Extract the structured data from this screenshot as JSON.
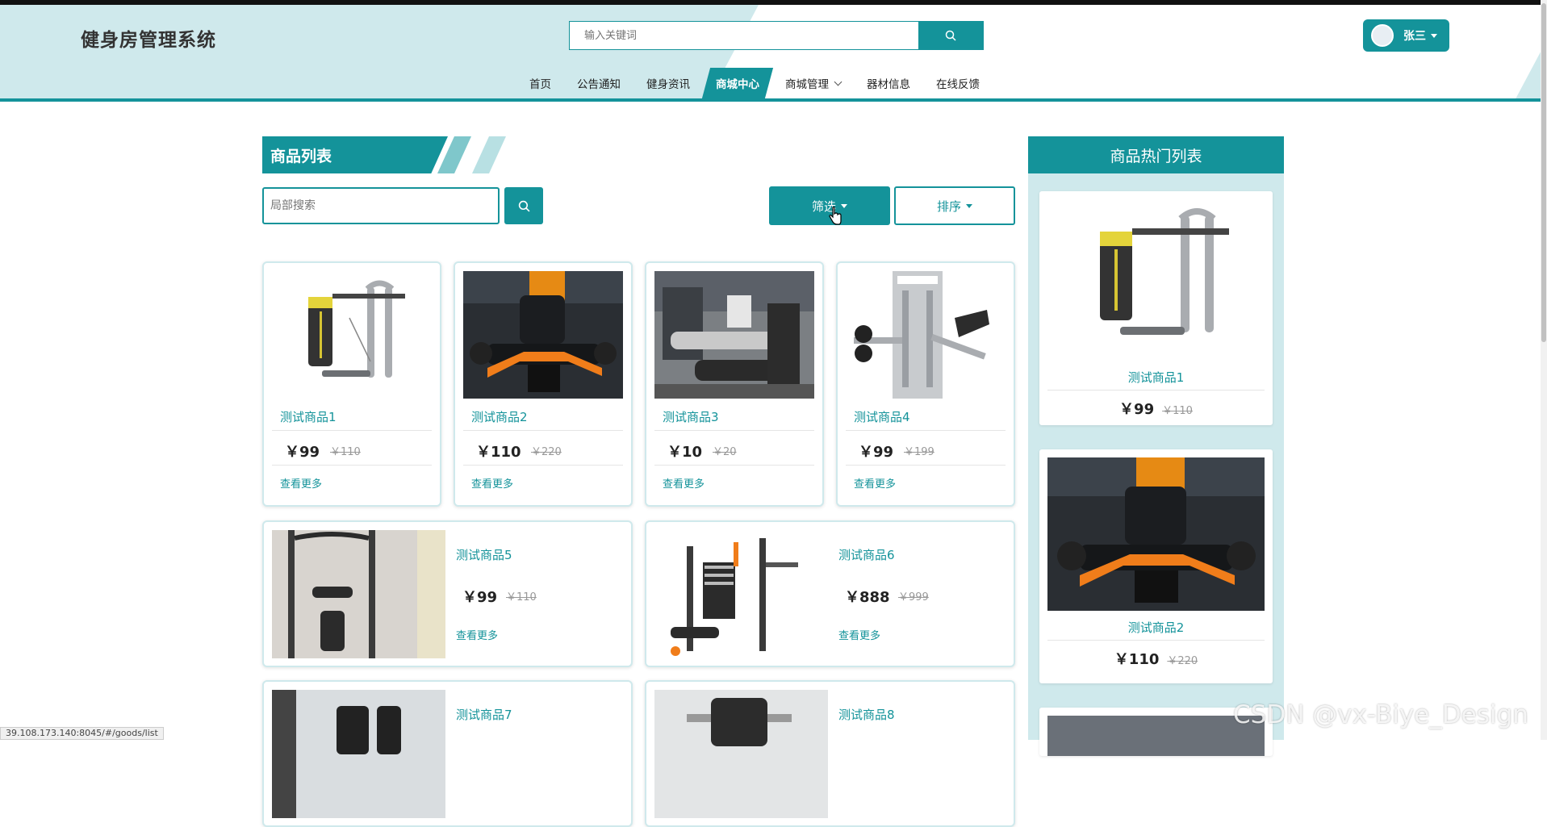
{
  "app": {
    "title": "健身房管理系统"
  },
  "search": {
    "placeholder": "输入关键词"
  },
  "user": {
    "name": "张三"
  },
  "nav": [
    {
      "label": "首页"
    },
    {
      "label": "公告通知"
    },
    {
      "label": "健身资讯"
    },
    {
      "label": "商城中心",
      "active": true
    },
    {
      "label": "商城管理",
      "dropdown": true
    },
    {
      "label": "器材信息"
    },
    {
      "label": "在线反馈"
    }
  ],
  "main": {
    "section_title": "商品列表",
    "local_search_placeholder": "局部搜索",
    "filter_label": "筛选",
    "sort_label": "排序",
    "more_label": "查看更多",
    "products": [
      {
        "name": "测试商品1",
        "price": "￥99",
        "old_price": "￥110"
      },
      {
        "name": "测试商品2",
        "price": "￥110",
        "old_price": "￥220"
      },
      {
        "name": "测试商品3",
        "price": "￥10",
        "old_price": "￥20"
      },
      {
        "name": "测试商品4",
        "price": "￥99",
        "old_price": "￥199"
      },
      {
        "name": "测试商品5",
        "price": "￥99",
        "old_price": "￥110"
      },
      {
        "name": "测试商品6",
        "price": "￥888",
        "old_price": "￥999"
      },
      {
        "name": "测试商品7"
      },
      {
        "name": "测试商品8"
      }
    ]
  },
  "hot": {
    "title": "商品热门列表",
    "items": [
      {
        "name": "测试商品1",
        "price": "￥99",
        "old_price": "￥110"
      },
      {
        "name": "测试商品2",
        "price": "￥110",
        "old_price": "￥220"
      }
    ]
  },
  "status_url": "39.108.173.140:8045/#/goods/list",
  "watermark": "CSDN @vx-Biye_Design",
  "colors": {
    "accent": "#14939a",
    "header_bg": "#cfe9ec",
    "panel_bg": "#cfe9ec"
  },
  "icons": {
    "search": "search-icon",
    "caret": "caret-down-icon",
    "chevron": "chevron-down-icon",
    "cursor": "hand-cursor-icon"
  }
}
